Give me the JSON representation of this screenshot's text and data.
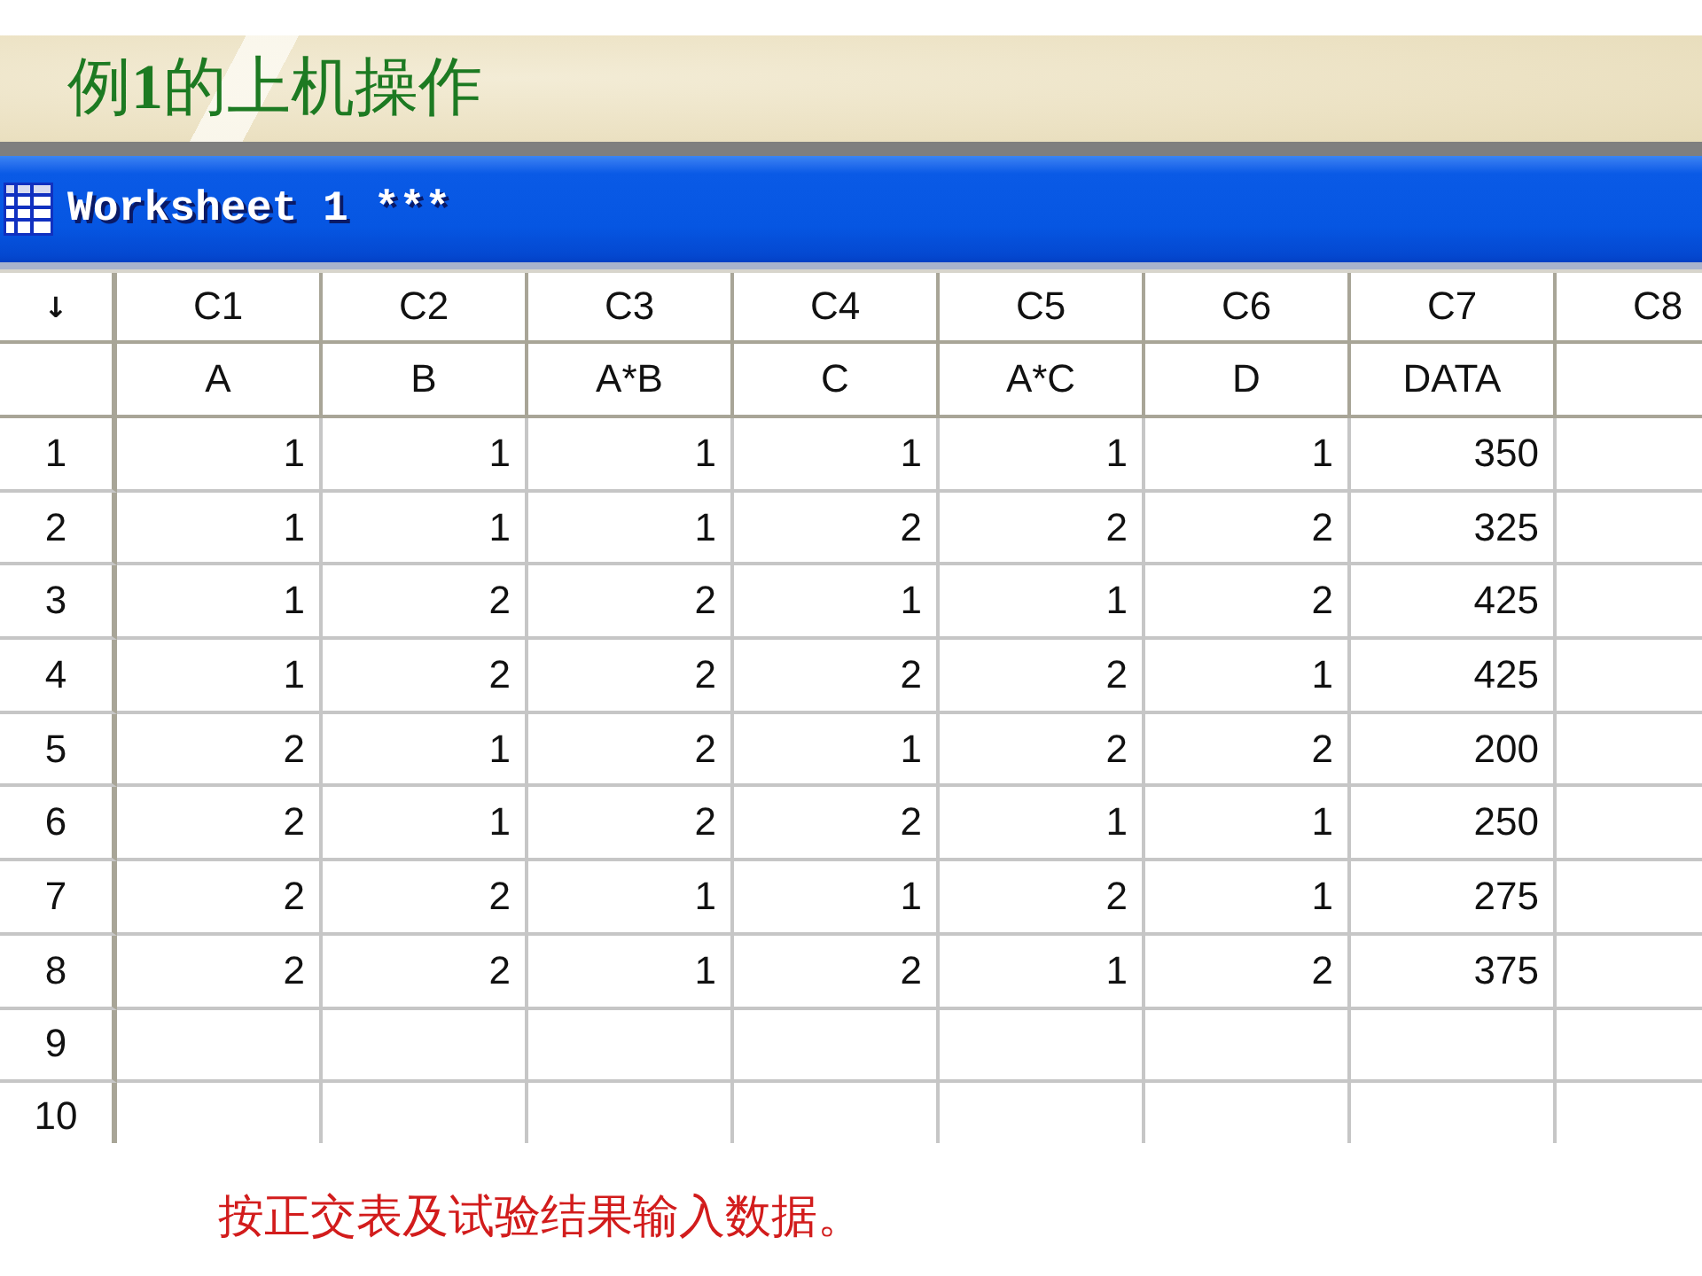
{
  "slide": {
    "title": "例**1**的上机操作"
  },
  "window": {
    "title": "Worksheet 1 ***"
  },
  "table": {
    "corner": "↓",
    "columns": [
      {
        "id": "C1",
        "name": "A"
      },
      {
        "id": "C2",
        "name": "B"
      },
      {
        "id": "C3",
        "name": "A*B"
      },
      {
        "id": "C4",
        "name": "C"
      },
      {
        "id": "C5",
        "name": "A*C"
      },
      {
        "id": "C6",
        "name": "D"
      },
      {
        "id": "C7",
        "name": "DATA"
      },
      {
        "id": "C8"
      }
    ],
    "rows": [
      {
        "label": "1",
        "cells": [
          "1",
          "1",
          "1",
          "1",
          "1",
          "1",
          "350"
        ]
      },
      {
        "label": "2",
        "cells": [
          "1",
          "1",
          "1",
          "2",
          "2",
          "2",
          "325"
        ]
      },
      {
        "label": "3",
        "cells": [
          "1",
          "2",
          "2",
          "1",
          "1",
          "2",
          "425"
        ]
      },
      {
        "label": "4",
        "cells": [
          "1",
          "2",
          "2",
          "2",
          "2",
          "1",
          "425"
        ]
      },
      {
        "label": "5",
        "cells": [
          "2",
          "1",
          "2",
          "1",
          "2",
          "2",
          "200"
        ]
      },
      {
        "label": "6",
        "cells": [
          "2",
          "1",
          "2",
          "2",
          "1",
          "1",
          "250"
        ]
      },
      {
        "label": "7",
        "cells": [
          "2",
          "2",
          "1",
          "1",
          "2",
          "1",
          "275"
        ]
      },
      {
        "label": "8",
        "cells": [
          "2",
          "2",
          "1",
          "2",
          "1",
          "2",
          "375"
        ]
      },
      {
        "label": "9"
      },
      {
        "label": "10"
      }
    ]
  },
  "caption": "按正交表及试验结果输入数据。"
}
